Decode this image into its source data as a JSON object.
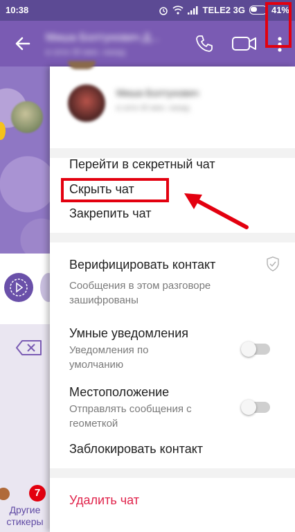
{
  "status_bar": {
    "time": "10:38",
    "carrier": "TELE2 3G",
    "battery": "41%"
  },
  "app_bar": {
    "contact_name": "Миша Болтунович Д...",
    "contact_status": "в сети 30 мин. назад",
    "accent_color": "#7a5bb3"
  },
  "chat": {
    "badge_count": "7",
    "stickers_label_line1": "Другие",
    "stickers_label_line2": "стикеры"
  },
  "drawer": {
    "contact": {
      "name": "Миша Болтунович",
      "status": "в сети 30 мин. назад"
    },
    "menu": {
      "secret_chat": "Перейти в секретный чат",
      "hide_chat": "Скрыть чат",
      "pin_chat": "Закрепить чат"
    },
    "verify": {
      "label": "Верифицировать контакт",
      "description": "Сообщения в этом разговоре зашифрованы"
    },
    "smart_notifications": {
      "label": "Умные уведомления",
      "description": "Уведомления по умолчанию",
      "enabled": false
    },
    "location": {
      "label": "Местоположение",
      "description": "Отправлять сообщения с геометкой",
      "enabled": false
    },
    "block": "Заблокировать контакт",
    "delete": "Удалить чат",
    "delete_color": "#e0224a"
  },
  "annotation_color": "#e3000f"
}
